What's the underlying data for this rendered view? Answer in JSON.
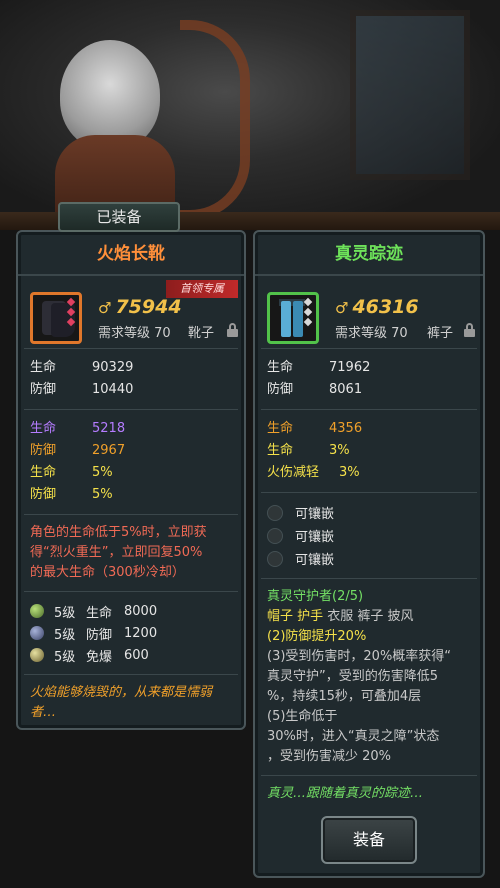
{
  "equipped_tab": "已装备",
  "left": {
    "title": "火焰长靴",
    "badge": "首领专属",
    "power": "75944",
    "requirement": "需求等级 70",
    "slot": "靴子",
    "base_stats": [
      {
        "k": "生命",
        "v": "90329"
      },
      {
        "k": "防御",
        "v": "10440"
      }
    ],
    "extra_stats": [
      {
        "k": "生命",
        "v": "5218",
        "color": "#b57cff"
      },
      {
        "k": "防御",
        "v": "2967",
        "color": "#f0a02a"
      },
      {
        "k": "生命",
        "v": "5%",
        "color": "#f5e14a"
      },
      {
        "k": "防御",
        "v": "5%",
        "color": "#f5e14a"
      }
    ],
    "special": [
      "角色的生命低于5%时，立即获",
      "得“烈火重生”，立即回复50%",
      "的最大生命（300秒冷却）"
    ],
    "gems": [
      {
        "level": "5级",
        "name": "生命",
        "value": "8000",
        "icon": "green-gem-icon"
      },
      {
        "level": "5级",
        "name": "防御",
        "value": "1200",
        "icon": "blue-gem-icon"
      },
      {
        "level": "5级",
        "name": "免爆",
        "value": "600",
        "icon": "gold-gem-icon"
      }
    ],
    "flavor": [
      "火焰能够烧毁的，从来都是懦弱",
      "者…"
    ]
  },
  "right": {
    "title": "真灵踪迹",
    "power": "46316",
    "requirement": "需求等级 70",
    "slot": "裤子",
    "base_stats": [
      {
        "k": "生命",
        "v": "71962"
      },
      {
        "k": "防御",
        "v": "8061"
      }
    ],
    "extra_stats": [
      {
        "k": "生命",
        "v": "4356",
        "color": "#f0a02a"
      },
      {
        "k": "生命",
        "v": "3%",
        "color": "#f5e14a"
      },
      {
        "k": "火伤减轻",
        "v": "3%",
        "color": "#f5e14a"
      }
    ],
    "sockets": [
      "可镶嵌",
      "可镶嵌",
      "可镶嵌"
    ],
    "set_name": "真灵守护者(2/5)",
    "set_parts_owned": "帽子 护手",
    "set_parts_missing": "衣服 裤子 披风",
    "set_bonus_active": "(2)防御提升20%",
    "set_bonus_lines": [
      "(3)受到伤害时，20%概率获得“",
      "真灵守护”，受到的伤害降低5",
      "%，持续15秒，可叠加4层",
      "(5)生命低于",
      "30%时，进入“真灵之障”状态",
      "，受到伤害减少 20%"
    ],
    "flavor": "真灵…跟随着真灵的踪迹…",
    "equip_button": "装备"
  },
  "colors": {
    "left_title": "#ff8f3a",
    "right_title": "#6ee35a",
    "power": "#f2c14a",
    "special_text": "#f06a55"
  }
}
